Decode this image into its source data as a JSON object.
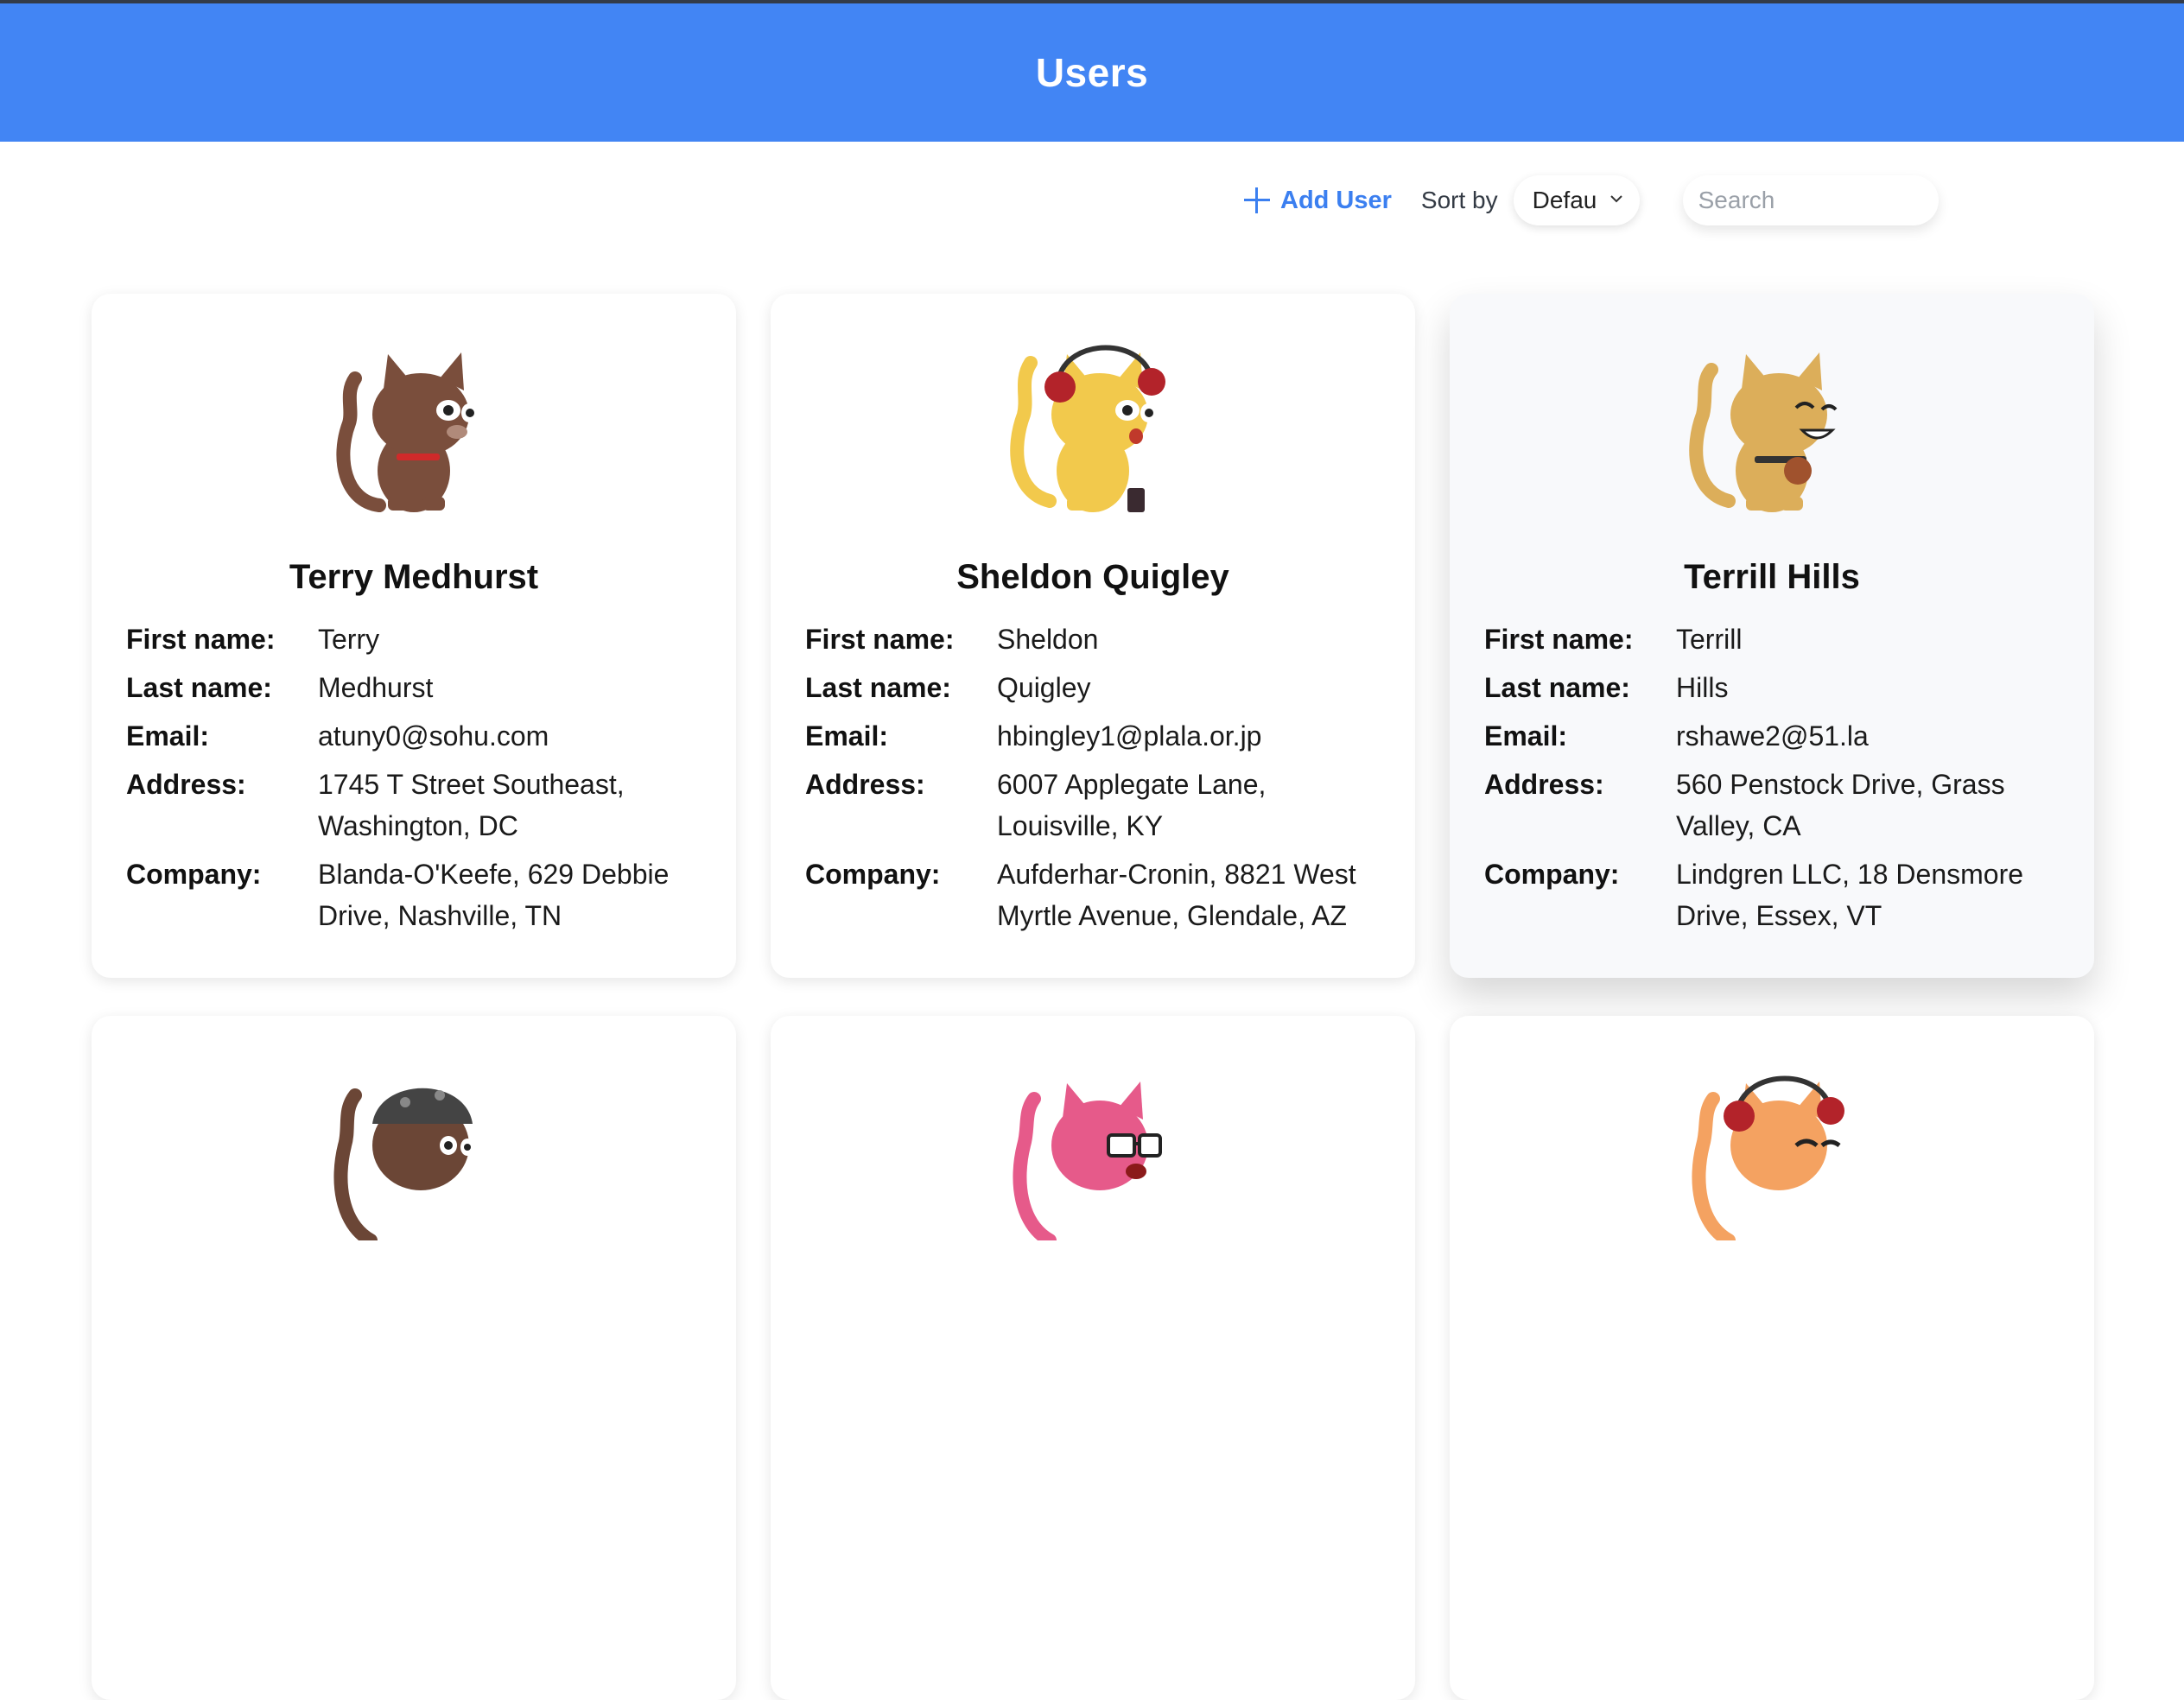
{
  "header": {
    "title": "Users"
  },
  "toolbar": {
    "add_user_label": "Add User",
    "sort_label": "Sort by",
    "sort_value": "Default",
    "search_placeholder": "Search"
  },
  "field_labels": {
    "first_name": "First name:",
    "last_name": "Last name:",
    "email": "Email:",
    "address": "Address:",
    "company": "Company:"
  },
  "users": [
    {
      "full_name": "Terry Medhurst",
      "first_name": "Terry",
      "last_name": "Medhurst",
      "email": "atuny0@sohu.com",
      "address": "1745 T Street Southeast, Washington, DC",
      "company": "Blanda-O'Keefe, 629 Debbie Drive, Nashville, TN"
    },
    {
      "full_name": "Sheldon Quigley",
      "first_name": "Sheldon",
      "last_name": "Quigley",
      "email": "hbingley1@plala.or.jp",
      "address": "6007 Applegate Lane, Louisville, KY",
      "company": "Aufderhar-Cronin, 8821 West Myrtle Avenue, Glendale, AZ"
    },
    {
      "full_name": "Terrill Hills",
      "first_name": "Terrill",
      "last_name": "Hills",
      "email": "rshawe2@51.la",
      "address": "560 Penstock Drive, Grass Valley, CA",
      "company": "Lindgren LLC, 18 Densmore Drive, Essex, VT"
    }
  ],
  "colors": {
    "header_bg": "#4285f4",
    "accent": "#3b7ff0"
  }
}
